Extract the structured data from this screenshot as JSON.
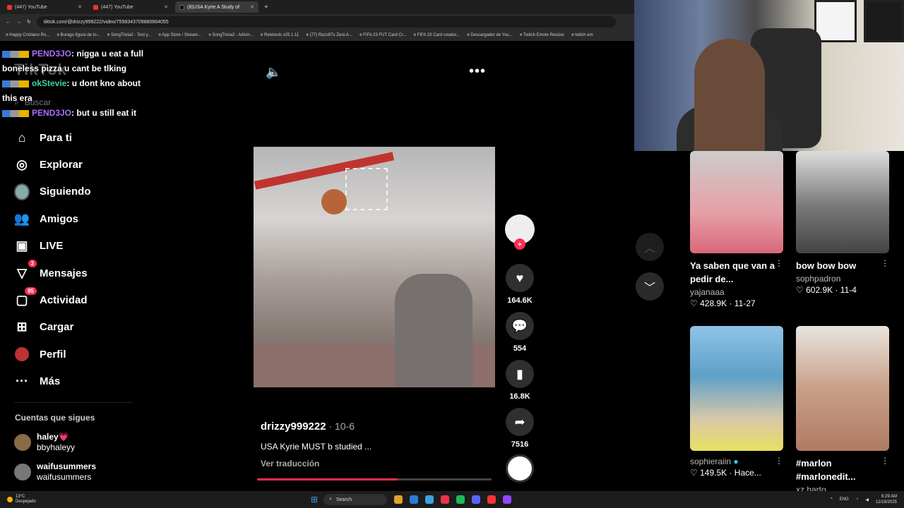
{
  "browser": {
    "tabs": [
      {
        "title": "(447) YouTube",
        "active": false
      },
      {
        "title": "(447) YouTube",
        "active": false
      },
      {
        "title": "(8)USA Kyrie A Study of",
        "active": true
      }
    ],
    "url": "tiktok.com/@drizzy999222/video/7558343709880864055",
    "bookmarks": [
      "Happy Cristiano Ro...",
      "Burago figura de to...",
      "SongTrivia2 - Test y...",
      "App Store / Stream...",
      "SongTrivia2 - Adivin...",
      "Reletools v25.1.11",
      "(77) Razo97s Zest-A...",
      "FIFA 23 FUT Card Cr...",
      "FIFA 23 Card creator...",
      "Descargador de You...",
      "Twitch Emote Resizer",
      "twitch em"
    ]
  },
  "chat": [
    {
      "user": "PEND3JO",
      "message": ": nigga u eat a full boneless pizza u cant be tlking"
    },
    {
      "user": "okStevie",
      "message": ": u dont kno about this era"
    },
    {
      "user": "PEND3JO",
      "message": ": but u still eat it"
    }
  ],
  "tiktok": {
    "logo": "TikTok",
    "search_placeholder": "Buscar",
    "nav": [
      {
        "label": "Para ti",
        "icon": "home-icon"
      },
      {
        "label": "Explorar",
        "icon": "compass-icon"
      },
      {
        "label": "Siguiendo",
        "icon": "following-avatar-icon"
      },
      {
        "label": "Amigos",
        "icon": "friends-icon"
      },
      {
        "label": "LIVE",
        "icon": "live-tv-icon"
      },
      {
        "label": "Mensajes",
        "icon": "messages-icon",
        "badge": "3"
      },
      {
        "label": "Actividad",
        "icon": "activity-icon",
        "badge": "85"
      },
      {
        "label": "Cargar",
        "icon": "upload-icon"
      },
      {
        "label": "Perfil",
        "icon": "profile-icon"
      },
      {
        "label": "Más",
        "icon": "more-icon"
      }
    ],
    "following_title": "Cuentas que sigues",
    "following": [
      {
        "name": "haley💗",
        "handle": "bbyhaleyy"
      },
      {
        "name": "waifusummers",
        "handle": "waifusummers"
      }
    ],
    "video": {
      "likes": "164.6K",
      "comments": "554",
      "saves": "16.8K",
      "shares": "7516",
      "author": "drizzy999222",
      "date": " · 10-6",
      "caption": "USA Kyrie MUST b studied ...",
      "translate": "Ver traducción",
      "progress": 0.6
    },
    "feed": [
      {
        "title": "Ya saben que van a pedir de...",
        "user": "yajanaaa",
        "stats": "♡ 428.9K · 11-27"
      },
      {
        "title": "bow bow bow",
        "user": "sophpadron",
        "stats": "♡ 602.9K · 11-4"
      },
      {
        "title": "",
        "user": "sophieraiin",
        "stats": "♡ 149.5K · Hace..."
      },
      {
        "title": "#marlon #marlonedit...",
        "user": "xz.harto",
        "stats": ""
      }
    ]
  },
  "taskbar": {
    "temp": "13°C",
    "weather": "Despejado",
    "search": "Search",
    "lang": "ENG",
    "time": "6:29 AM",
    "date": "12/18/2025"
  }
}
